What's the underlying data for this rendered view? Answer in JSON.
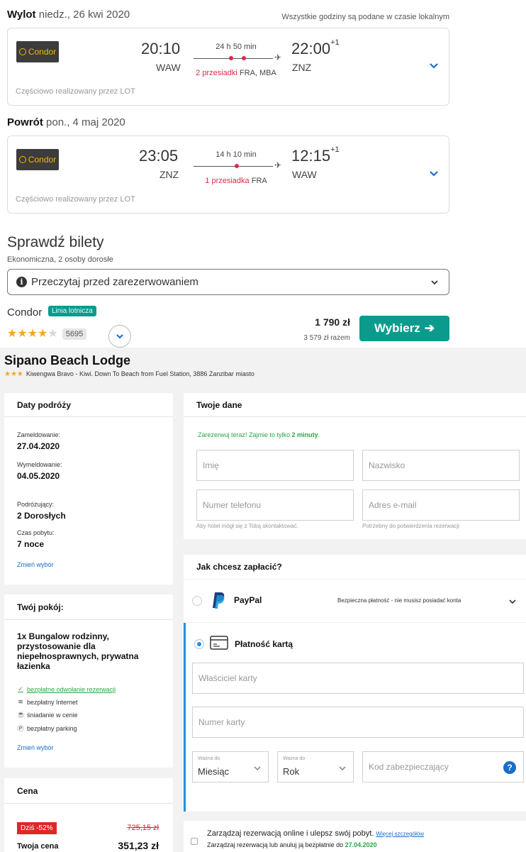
{
  "flights": {
    "timezone_note": "Wszystkie godziny są podane w czasie lokalnym",
    "outbound": {
      "label": "Wylot",
      "date": "niedz., 26 kwi 2020",
      "airline_logo_text": "Condor",
      "dep_time": "20:10",
      "dep_code": "WAW",
      "duration": "24 h 50 min",
      "stops_text": "2 przesiadki",
      "stops_airports": "FRA, MBA",
      "arr_time": "22:00",
      "arr_day_offset": "+1",
      "arr_code": "ZNZ",
      "operated_by": "Częściowo realizowany przez LOT"
    },
    "inbound": {
      "label": "Powrót",
      "date": "pon., 4 maj 2020",
      "airline_logo_text": "Condor",
      "dep_time": "23:05",
      "dep_code": "ZNZ",
      "duration": "14 h 10 min",
      "stops_text": "1 przesiadka",
      "stops_airports": "FRA",
      "arr_time": "12:15",
      "arr_day_offset": "+1",
      "arr_code": "WAW",
      "operated_by": "Częściowo realizowany przez LOT"
    },
    "tickets": {
      "title": "Sprawdź bilety",
      "subtitle": "Ekonomiczna, 2 osoby dorosłe",
      "read_before": "Przeczytaj przed zarezerwowaniem",
      "airline": "Condor",
      "airline_badge": "Linia lotnicza",
      "rating_stars": 4,
      "rating_max": 5,
      "review_count": "5695",
      "price": "1 790 zł",
      "price_total": "3 579 zł razem",
      "choose_button": "Wybierz"
    }
  },
  "hotel": {
    "name": "Sipano Beach Lodge",
    "stars": 3,
    "address": "Kiwengwa Bravo - Kiwi. Down To Beach from Fuel Station, 3886 Zanzibar miasto",
    "dates_panel": {
      "title": "Daty podróży",
      "checkin_label": "Zameldowanie:",
      "checkin": "27.04.2020",
      "checkout_label": "Wymeldowanie:",
      "checkout": "04.05.2020",
      "travelers_label": "Podróżujący:",
      "travelers": "2 Dorosłych",
      "stay_label": "Czas pobytu:",
      "stay": "7 noce",
      "change_link": "Zmień wybór"
    },
    "room_panel": {
      "title": "Twój pokój:",
      "room_name": "1x Bungalow rodzinny, przystosowanie dla niepełnosprawnych, prywatna łazienka",
      "amenities": [
        {
          "icon": "check-icon",
          "text": "bezpłatne odwołanie rezerwacji"
        },
        {
          "icon": "wifi-icon",
          "text": "bezpłatny Internet"
        },
        {
          "icon": "breakfast-icon",
          "text": "śniadanie w cenie"
        },
        {
          "icon": "parking-icon",
          "text": "bezpłatny parking"
        }
      ],
      "change_link": "Zmień wybór"
    },
    "price_panel": {
      "title": "Cena",
      "discount": "Dziś -52%",
      "old_price": "725,15 zł",
      "your_price_label": "Twoja cena",
      "your_price": "351,23 zł"
    },
    "your_data": {
      "title": "Twoje dane",
      "note_pre": "Zarezerwuj teraz! Zajmie to tylko",
      "note_bold": "2 minuty",
      "first_name_ph": "Imię",
      "last_name_ph": "Nazwisko",
      "phone_ph": "Numer telefonu",
      "phone_hint": "Aby hotel mógł się z Tobą skontaktować.",
      "email_ph": "Adres e-mail",
      "email_hint": "Potrzebny do potwierdzenia rezerwacji"
    },
    "payment": {
      "title": "Jak chcesz zapłacić?",
      "paypal_label": "PayPal",
      "paypal_note": "Bezpieczna płatność - nie musisz posiadać konta",
      "card_label": "Płatność kartą",
      "card_holder_ph": "Właściciel karty",
      "card_number_ph": "Numer karty",
      "valid_to_label": "Ważna do",
      "month_value": "Miesiąc",
      "year_value": "Rok",
      "cvc_ph": "Kod zabezpieczający"
    },
    "manage": {
      "line1": "Zarządzaj rezerwacją online i ulepsz swój pobyt.",
      "more_link": "Więcej szczegółów",
      "line2_pre": "Zarządzaj rezerwacją lub anuluj ją bezpłatnie do",
      "line2_date": "27.04.2020"
    }
  },
  "colors": {
    "teal": "#0a9b8c",
    "red": "#e0284a",
    "blue": "#1a6cc9",
    "green": "#28a745",
    "star": "#f5a623"
  }
}
